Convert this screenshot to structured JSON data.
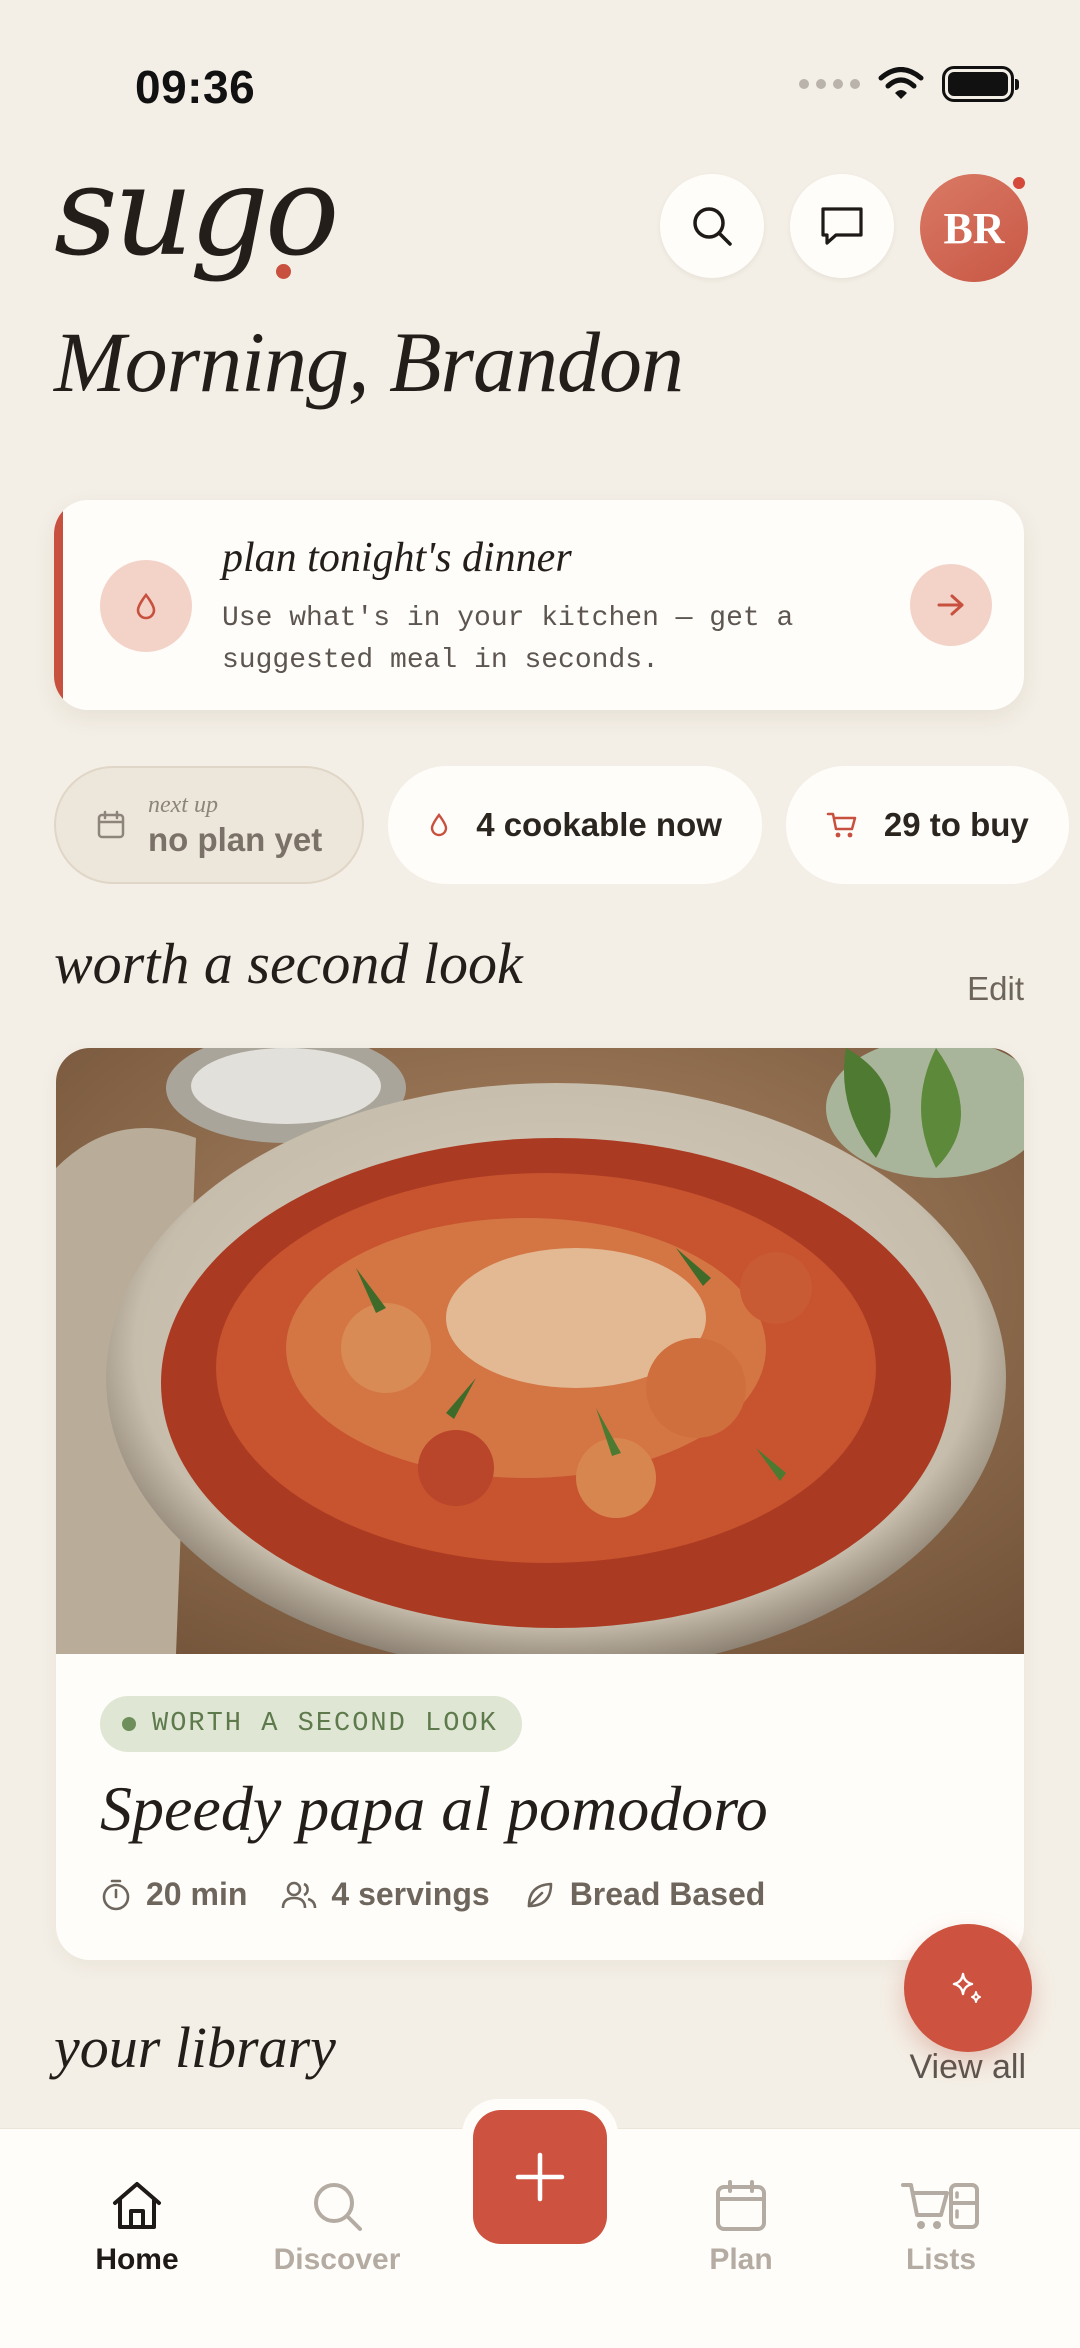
{
  "status_bar": {
    "time": "09:36"
  },
  "app": {
    "logo": "sugo",
    "greeting": "Morning, Brandon"
  },
  "header": {
    "avatar_initials": "BR"
  },
  "plan_card": {
    "title": "plan tonight's dinner",
    "description": "Use what's in your kitchen — get a suggested meal in seconds."
  },
  "chips": [
    {
      "small": "next up",
      "label": "no plan yet",
      "icon": "calendar-icon"
    },
    {
      "label": "4 cookable now",
      "icon": "drop-icon"
    },
    {
      "label": "29 to buy",
      "icon": "cart-icon"
    }
  ],
  "sections": {
    "second_look": {
      "title": "worth a second look",
      "action": "Edit"
    },
    "library": {
      "title": "your library",
      "action": "View all"
    }
  },
  "recipe": {
    "tag": "WORTH A SECOND LOOK",
    "title": "Speedy papa al pomodoro",
    "time": "20 min",
    "servings": "4 servings",
    "category": "Bread Based"
  },
  "tabs": [
    {
      "label": "Home",
      "icon": "home-icon",
      "active": true
    },
    {
      "label": "Discover",
      "icon": "search-icon"
    },
    {
      "label": "Plan",
      "icon": "calendar-icon"
    },
    {
      "label": "Lists",
      "icon": "cart-icon"
    }
  ],
  "colors": {
    "accent": "#cd5340",
    "background": "#f4efe6",
    "tag_green": "#5e7a4d"
  }
}
